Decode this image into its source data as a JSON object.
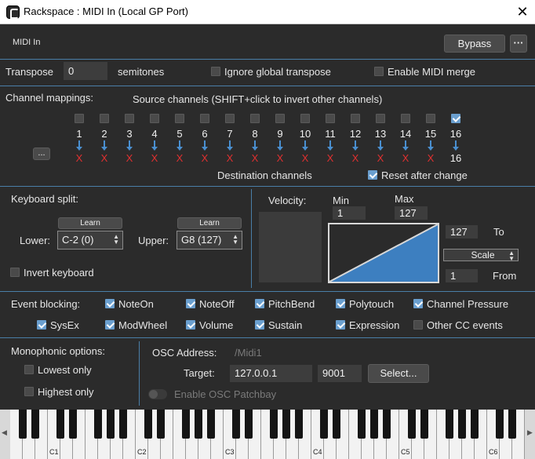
{
  "window": {
    "title": "Rackspace : MIDI In (Local GP Port)",
    "close_glyph": "✕"
  },
  "header": {
    "label": "MIDI In",
    "bypass_label": "Bypass",
    "more_label": "···"
  },
  "transpose": {
    "label": "Transpose",
    "value": "0",
    "unit": "semitones",
    "ignore_global_label": "Ignore global transpose",
    "ignore_global_checked": false,
    "enable_merge_label": "Enable MIDI merge",
    "enable_merge_checked": false
  },
  "channels": {
    "label": "Channel mappings:",
    "source_label": "Source channels (SHIFT+click to invert other channels)",
    "more_button": "...",
    "numbers": [
      "1",
      "2",
      "3",
      "4",
      "5",
      "6",
      "7",
      "8",
      "9",
      "10",
      "11",
      "12",
      "13",
      "14",
      "15",
      "16"
    ],
    "checked": [
      false,
      false,
      false,
      false,
      false,
      false,
      false,
      false,
      false,
      false,
      false,
      false,
      false,
      false,
      false,
      true
    ],
    "destinations": [
      "X",
      "X",
      "X",
      "X",
      "X",
      "X",
      "X",
      "X",
      "X",
      "X",
      "X",
      "X",
      "X",
      "X",
      "X",
      "16"
    ],
    "destination_label": "Destination channels",
    "reset_label": "Reset after change",
    "reset_checked": true
  },
  "keyboard_split": {
    "label": "Keyboard split:",
    "learn_label": "Learn",
    "lower_label": "Lower:",
    "lower_value": "C-2 (0)",
    "upper_label": "Upper:",
    "upper_value": "G8 (127)",
    "invert_label": "Invert keyboard",
    "invert_checked": false
  },
  "velocity": {
    "label": "Velocity:",
    "min_label": "Min",
    "min_value": "1",
    "max_label": "Max",
    "max_value": "127",
    "to_value": "127",
    "to_label": "To",
    "mode_value": "Scale",
    "from_value": "1",
    "from_label": "From"
  },
  "event_blocking": {
    "label": "Event blocking:",
    "items": [
      {
        "label": "NoteOn",
        "checked": true
      },
      {
        "label": "NoteOff",
        "checked": true
      },
      {
        "label": "PitchBend",
        "checked": true
      },
      {
        "label": "Polytouch",
        "checked": true
      },
      {
        "label": "Channel Pressure",
        "checked": true
      },
      {
        "label": "SysEx",
        "checked": true
      },
      {
        "label": "ModWheel",
        "checked": true
      },
      {
        "label": "Volume",
        "checked": true
      },
      {
        "label": "Sustain",
        "checked": true
      },
      {
        "label": "Expression",
        "checked": true
      },
      {
        "label": "Other CC events",
        "checked": false
      }
    ]
  },
  "mono": {
    "label": "Monophonic options:",
    "lowest_label": "Lowest only",
    "lowest_checked": false,
    "highest_label": "Highest only",
    "highest_checked": false
  },
  "osc": {
    "address_label": "OSC Address:",
    "address_value": "/Midi1",
    "target_label": "Target:",
    "ip_value": "127.0.0.1",
    "port_value": "9001",
    "select_label": "Select...",
    "patchbay_label": "Enable OSC Patchbay",
    "patchbay_enabled": false
  },
  "piano": {
    "octave_labels": [
      "C1",
      "C2",
      "C3",
      "C4",
      "C5",
      "C6"
    ],
    "left_arrow": "◀",
    "right_arrow": "▶"
  },
  "colors": {
    "accent": "#4a7fa8",
    "check": "#6a9fcf",
    "arrow": "#4a8fd0",
    "x_mark": "#e03030",
    "velocity_fill": "#3d7fc0"
  }
}
